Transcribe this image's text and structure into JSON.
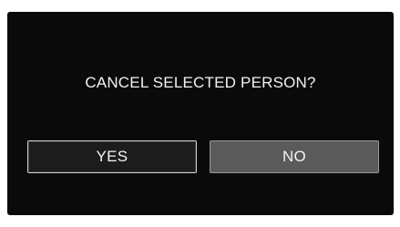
{
  "dialog": {
    "message": "CANCEL SELECTED PERSON?",
    "buttons": {
      "yes_label": "YES",
      "no_label": "NO"
    }
  },
  "colors": {
    "screen_background": "#0a0a0a",
    "text": "#f2f2f2",
    "yes_button_background": "#1c1c1c",
    "no_button_background": "#5a5a5a"
  }
}
